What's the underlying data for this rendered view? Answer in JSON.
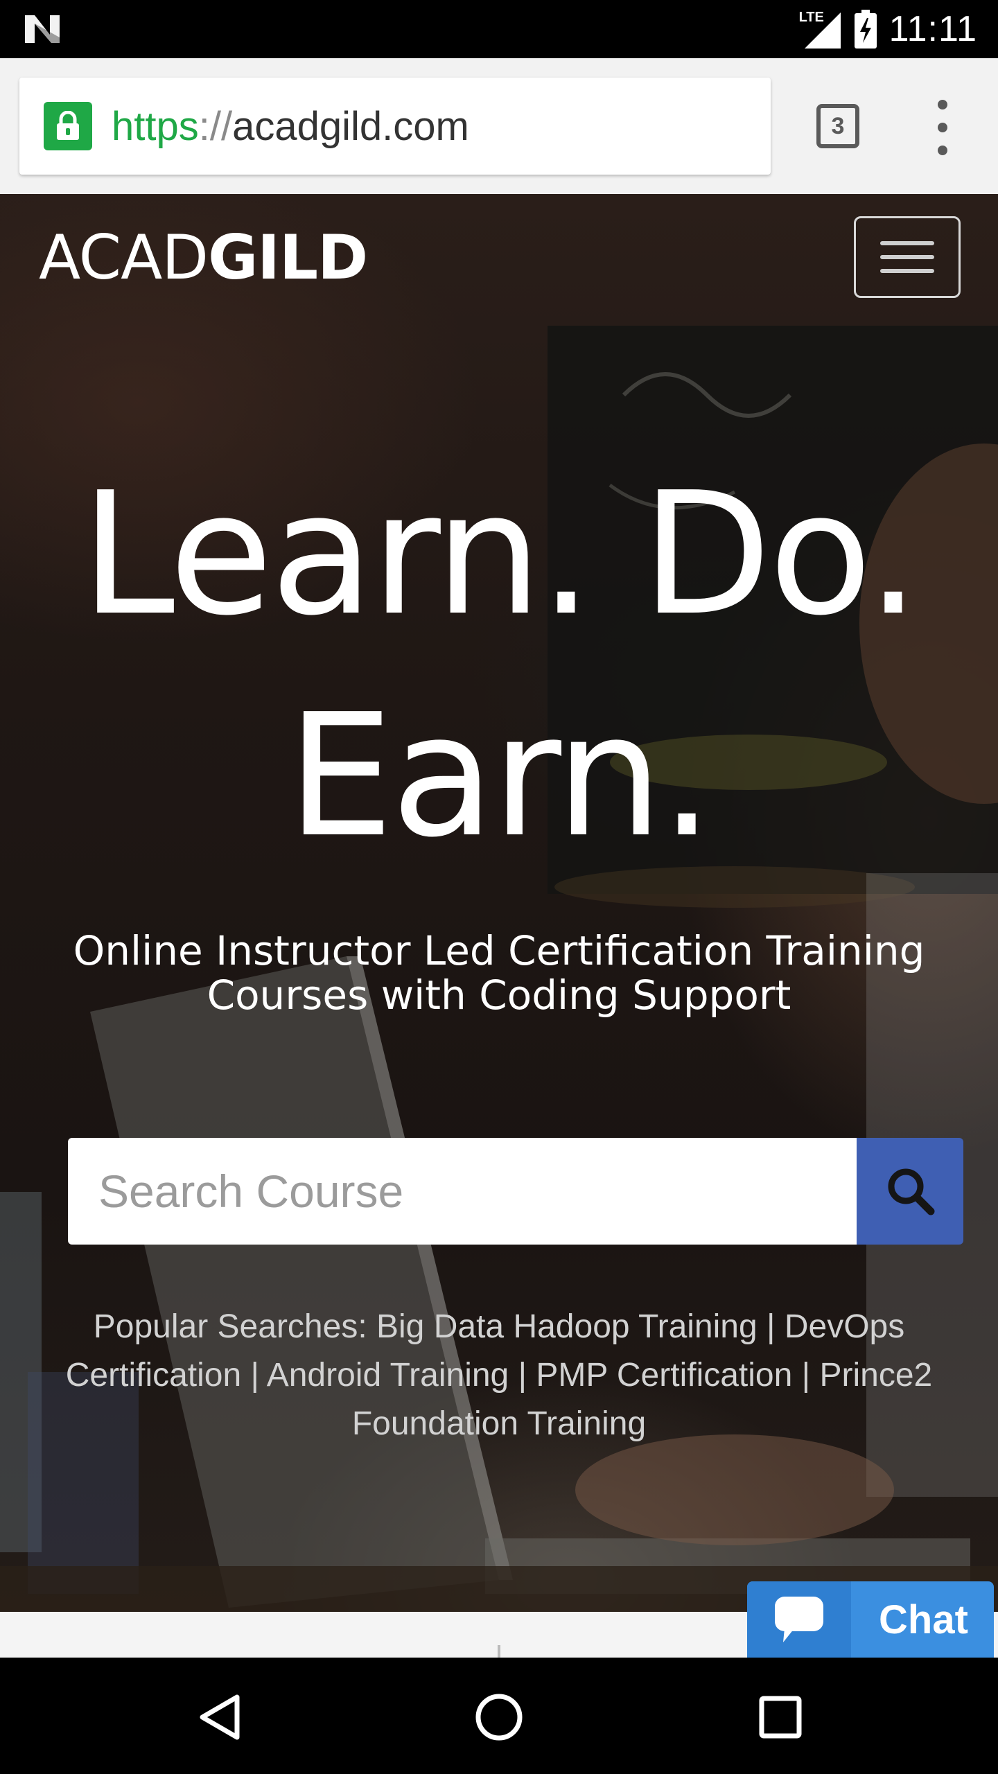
{
  "status_bar": {
    "time": "11:11",
    "network": "LTE",
    "notification_icon": "n-icon",
    "signal_icon": "signal-icon",
    "battery_icon": "battery-charging-icon"
  },
  "browser": {
    "url_scheme": "https",
    "url_separator": "://",
    "url_host": "acadgild.com",
    "tab_count": "3",
    "lock_icon": "lock-icon",
    "menu_icon": "overflow-menu-icon"
  },
  "site": {
    "brand_light": "ACAD",
    "brand_bold": "GILD",
    "menu_toggle_icon": "hamburger-icon",
    "headline_line1": "Learn. Do.",
    "headline_line2": "Earn.",
    "subheadline_line1": "Online Instructor Led Certification Training",
    "subheadline_line2": "Courses with Coding Support",
    "search": {
      "placeholder": "Search Course",
      "value": "",
      "button_icon": "search-icon"
    },
    "popular": {
      "prefix": "Popular Searches:",
      "links": [
        "Big Data Hadoop Training",
        "DevOps Certification",
        "Android Training",
        "PMP Certification",
        "Prince2 Foundation Training"
      ],
      "separator": "|"
    }
  },
  "chat": {
    "label": "Chat",
    "icon": "chat-bubble-icon"
  },
  "nav_bar": {
    "back_icon": "back-icon",
    "home_icon": "home-icon",
    "recents_icon": "recents-icon"
  },
  "colors": {
    "secure_green": "#1fa846",
    "search_button": "#3f5fb3",
    "chat_blue": "#3b8fe0"
  }
}
